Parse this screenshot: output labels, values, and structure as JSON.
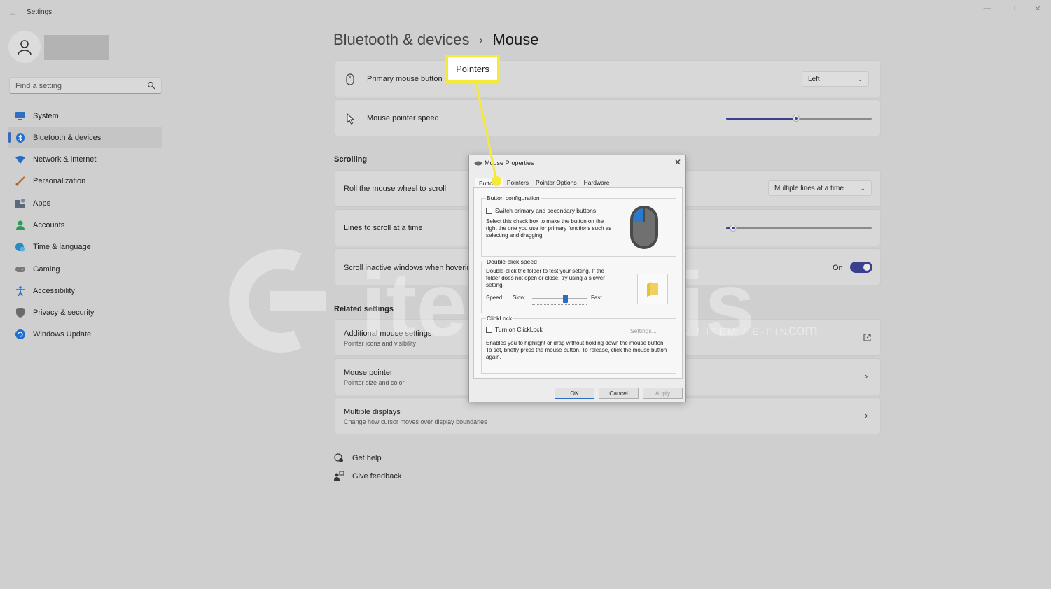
{
  "window": {
    "title": "Settings",
    "back_icon": "back-arrow-icon",
    "minimize_glyph": "—",
    "restore_glyph": "❐",
    "close_glyph": "✕"
  },
  "search": {
    "placeholder": "Find a setting"
  },
  "sidebar": {
    "items": [
      {
        "label": "System",
        "icon": "monitor-icon",
        "color": "#2f6fc2"
      },
      {
        "label": "Bluetooth & devices",
        "icon": "bluetooth-icon",
        "color": "#1f6fd0",
        "active": true
      },
      {
        "label": "Network & internet",
        "icon": "wifi-icon",
        "color": "#2a6ac0"
      },
      {
        "label": "Personalization",
        "icon": "brush-icon",
        "color": "#c06a2a"
      },
      {
        "label": "Apps",
        "icon": "apps-icon",
        "color": "#5a6a7a"
      },
      {
        "label": "Accounts",
        "icon": "person-icon",
        "color": "#2e9a5a"
      },
      {
        "label": "Time & language",
        "icon": "globe-clock-icon",
        "color": "#2a8ac0"
      },
      {
        "label": "Gaming",
        "icon": "gamepad-icon",
        "color": "#7a7a7a"
      },
      {
        "label": "Accessibility",
        "icon": "accessibility-icon",
        "color": "#1f6fd0"
      },
      {
        "label": "Privacy & security",
        "icon": "shield-icon",
        "color": "#6a6a6a"
      },
      {
        "label": "Windows Update",
        "icon": "update-icon",
        "color": "#1f6fd0"
      }
    ]
  },
  "breadcrumb": {
    "parent": "Bluetooth & devices",
    "separator": "›",
    "current": "Mouse"
  },
  "settings": {
    "primary_button": {
      "label": "Primary mouse button",
      "value": "Left"
    },
    "pointer_speed": {
      "label": "Mouse pointer speed",
      "value_fraction": 0.48
    },
    "scrolling_heading": "Scrolling",
    "roll_wheel": {
      "label": "Roll the mouse wheel to scroll",
      "value": "Multiple lines at a time"
    },
    "lines_to_scroll": {
      "label": "Lines to scroll at a time",
      "value_fraction": 0.05
    },
    "scroll_inactive": {
      "label": "Scroll inactive windows when hovering over them",
      "state": "On"
    },
    "related_heading": "Related settings",
    "related": [
      {
        "title": "Additional mouse settings",
        "subtitle": "Pointer icons and visibility",
        "icon": "external-link-icon"
      },
      {
        "title": "Mouse pointer",
        "subtitle": "Pointer size and color",
        "icon": "chevron-right-icon"
      },
      {
        "title": "Multiple displays",
        "subtitle": "Change how cursor moves over display boundaries",
        "icon": "chevron-right-icon"
      }
    ],
    "help": {
      "get_help": "Get help",
      "feedback": "Give feedback"
    }
  },
  "callout": {
    "text": "Pointers",
    "color": "#f5ea3a"
  },
  "dialog": {
    "title": "Mouse Properties",
    "tabs": [
      "Buttons",
      "Pointers",
      "Pointer Options",
      "Hardware"
    ],
    "button_config": {
      "title": "Button configuration",
      "checkbox": "Switch primary and secondary buttons",
      "desc": "Select this check box to make the button on the right the one you use for primary functions such as selecting and dragging."
    },
    "double_click": {
      "title": "Double-click speed",
      "desc": "Double-click the folder to test your setting. If the folder does not open or close, try using a slower setting.",
      "speed_label": "Speed:",
      "slow": "Slow",
      "fast": "Fast",
      "value_fraction": 0.6
    },
    "clicklock": {
      "title": "ClickLock",
      "checkbox": "Turn on ClickLock",
      "settings_btn": "Settings...",
      "desc": "Enables you to highlight or drag without holding down the mouse button. To set, briefly press the mouse button. To release, click the mouse button again."
    },
    "buttons": {
      "ok": "OK",
      "cancel": "Cancel",
      "apply": "Apply"
    }
  },
  "watermark": {
    "text": "itemsatis",
    "sub": "HESAP / SKIN / ITEM / E-PIN",
    "suffix": ".com"
  }
}
